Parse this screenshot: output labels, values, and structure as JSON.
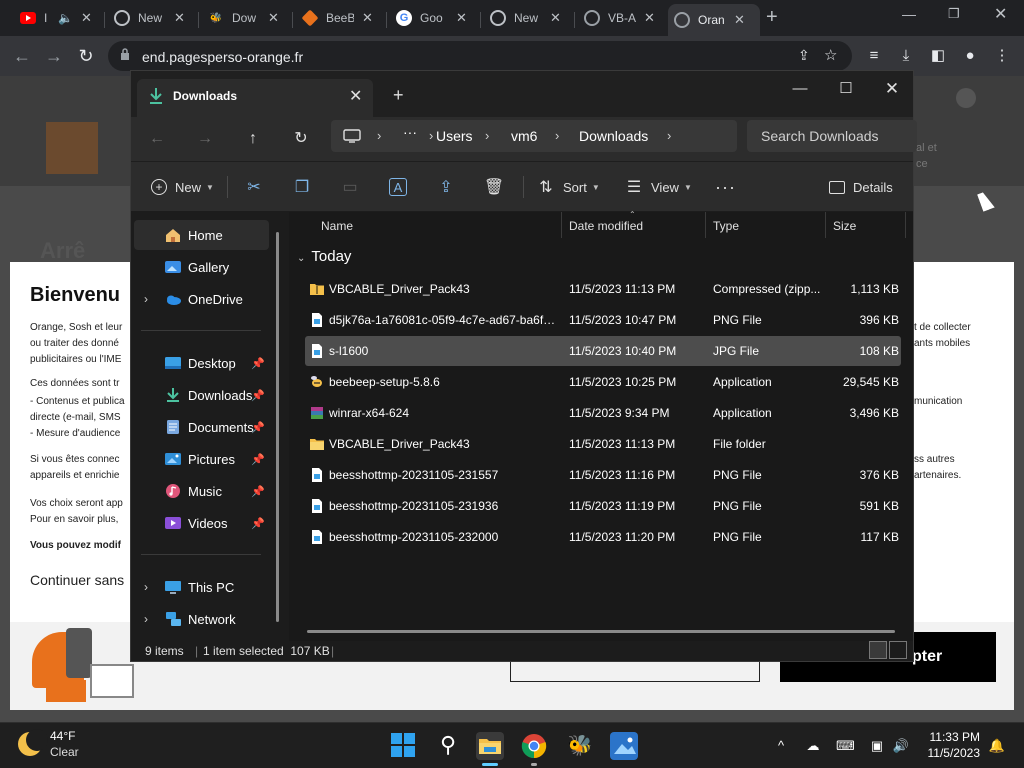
{
  "browser": {
    "tabs": [
      {
        "label": "I",
        "icon": "youtube-icon",
        "color": "#ff0000"
      },
      {
        "label": "New",
        "icon": "chrome-icon",
        "color": "#bdc1c6"
      },
      {
        "label": "Dow",
        "icon": "beebeep-icon",
        "color": "#d9b84a"
      },
      {
        "label": "BeeB",
        "icon": "beebeep-diamond-icon",
        "color": "#e8711c"
      },
      {
        "label": "Goo",
        "icon": "google-icon",
        "color": "#4285f4"
      },
      {
        "label": "New",
        "icon": "chrome-icon",
        "color": "#bdc1c6"
      },
      {
        "label": "VB-A",
        "icon": "vb-audio-icon",
        "color": "#9aa0a6"
      },
      {
        "label": "Oran",
        "icon": "globe-icon",
        "color": "#9aa0a6"
      }
    ],
    "url": "end.pagesperso-orange.fr"
  },
  "webpage": {
    "title": "Bienvenu",
    "background_heading": "Arrê",
    "text_lines": [
      "Orange, Sosh et leur",
      "ou traiter des donné",
      "publicitaires ou l'IME",
      "Ces données sont tr",
      "- Contenus et publica",
      "directe (e-mail, SMS",
      "- Mesure d'audience",
      "Si vous êtes connec",
      "appareils et enrichie",
      "Vos choix seront app",
      "Pour en savoir plus,"
    ],
    "bold_line": "Vous pouvez modif",
    "continue_text": "Continuer sans",
    "right_fragments": [
      "t de collecter",
      "ants mobiles",
      "munication",
      "ss autres",
      "artenaires."
    ],
    "header_fragments": [
      "al et",
      "ce"
    ],
    "accept_label": "pter"
  },
  "explorer": {
    "tab_title": "Downloads",
    "breadcrumbs": [
      "Users",
      "vm6",
      "Downloads"
    ],
    "search_placeholder": "Search Downloads",
    "commands": {
      "new": "New",
      "sort": "Sort",
      "view": "View",
      "details": "Details"
    },
    "sidebar": [
      {
        "label": "Home",
        "icon": "home-icon",
        "selected": true
      },
      {
        "label": "Gallery",
        "icon": "gallery-icon"
      },
      {
        "label": "OneDrive",
        "icon": "onedrive-icon",
        "expandable": true
      },
      {
        "label": "Desktop",
        "icon": "desktop-icon",
        "pinned": true
      },
      {
        "label": "Downloads",
        "icon": "download-icon",
        "pinned": true
      },
      {
        "label": "Documents",
        "icon": "documents-icon",
        "pinned": true
      },
      {
        "label": "Pictures",
        "icon": "pictures-icon",
        "pinned": true
      },
      {
        "label": "Music",
        "icon": "music-icon",
        "pinned": true
      },
      {
        "label": "Videos",
        "icon": "videos-icon",
        "pinned": true
      },
      {
        "label": "This PC",
        "icon": "this-pc-icon",
        "expandable": true
      },
      {
        "label": "Network",
        "icon": "network-icon",
        "expandable": true
      }
    ],
    "columns": [
      "Name",
      "Date modified",
      "Type",
      "Size"
    ],
    "group": "Today",
    "files": [
      {
        "name": "VBCABLE_Driver_Pack43",
        "date": "11/5/2023 11:13 PM",
        "type": "Compressed (zipp...",
        "size": "1,113 KB",
        "icon": "zip-folder-icon"
      },
      {
        "name": "d5jk76a-1a76081c-05f9-4c7e-ad67-ba6f5...",
        "date": "11/5/2023 10:47 PM",
        "type": "PNG File",
        "size": "396 KB",
        "icon": "png-file-icon"
      },
      {
        "name": "s-l1600",
        "date": "11/5/2023 10:40 PM",
        "type": "JPG File",
        "size": "108 KB",
        "icon": "jpg-file-icon",
        "selected": true
      },
      {
        "name": "beebeep-setup-5.8.6",
        "date": "11/5/2023 10:25 PM",
        "type": "Application",
        "size": "29,545 KB",
        "icon": "beebeep-app-icon"
      },
      {
        "name": "winrar-x64-624",
        "date": "11/5/2023 9:34 PM",
        "type": "Application",
        "size": "3,496 KB",
        "icon": "winrar-icon"
      },
      {
        "name": "VBCABLE_Driver_Pack43",
        "date": "11/5/2023 11:13 PM",
        "type": "File folder",
        "size": "",
        "icon": "folder-icon"
      },
      {
        "name": "beesshottmp-20231105-231557",
        "date": "11/5/2023 11:16 PM",
        "type": "PNG File",
        "size": "376 KB",
        "icon": "png-file-icon"
      },
      {
        "name": "beesshottmp-20231105-231936",
        "date": "11/5/2023 11:19 PM",
        "type": "PNG File",
        "size": "591 KB",
        "icon": "png-file-icon"
      },
      {
        "name": "beesshottmp-20231105-232000",
        "date": "11/5/2023 11:20 PM",
        "type": "PNG File",
        "size": "117 KB",
        "icon": "png-file-icon"
      }
    ],
    "status": {
      "count": "9 items",
      "selection": "1 item selected  107 KB"
    }
  },
  "taskbar": {
    "weather_temp": "44°F",
    "weather_desc": "Clear",
    "time": "11:33 PM",
    "date": "11/5/2023"
  },
  "colors": {
    "accent": "#0078d4",
    "selection": "#4d4d4d",
    "folder": "#f5c04a"
  }
}
